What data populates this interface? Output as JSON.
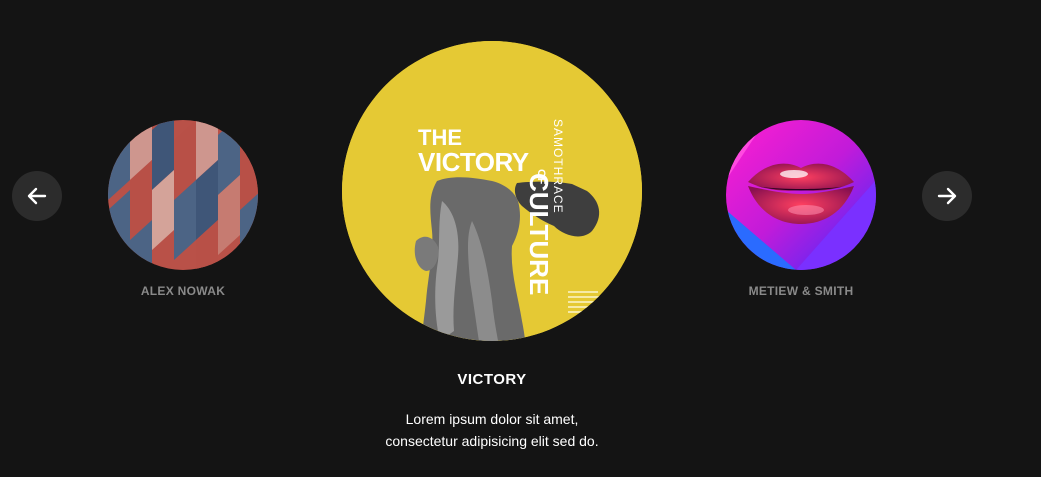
{
  "slider": {
    "prev_icon": "arrow-left-icon",
    "next_icon": "arrow-right-icon",
    "left_item": {
      "name": "ALEX NOWAK",
      "image": "red-blue-geometric-pattern-artwork"
    },
    "center_item": {
      "title": "VICTORY",
      "description_line1": "Lorem ipsum dolor sit amet,",
      "description_line2": "consectetur adipisicing elit sed do.",
      "image": "victory-of-samothrace-yellow-poster",
      "poster_text": {
        "the": "THE",
        "victory": "VICTORY",
        "of": "OF",
        "culture": "CULTURE",
        "samothrace": "SAMOTHRACE"
      }
    },
    "right_item": {
      "name": "METIEW & SMITH",
      "image": "neon-pink-blue-lips-artwork"
    }
  },
  "colors": {
    "background": "#141414",
    "nav_button": "#2c2c2c",
    "poster_yellow": "#e5c934",
    "side_label": "#8a8a8a"
  }
}
